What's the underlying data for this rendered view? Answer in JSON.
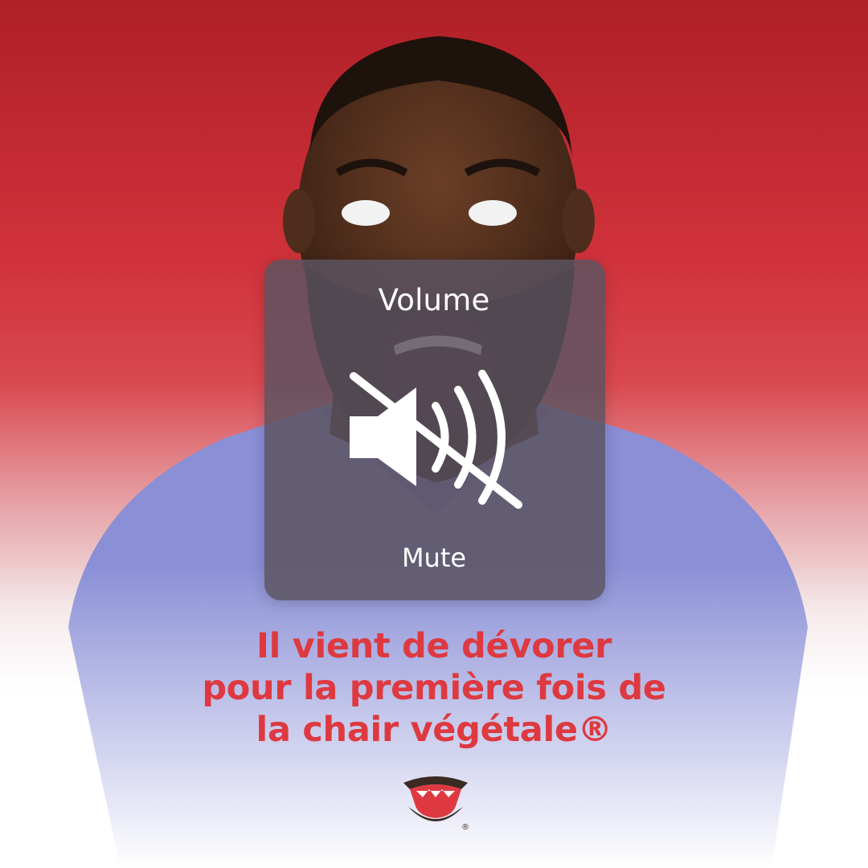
{
  "hud": {
    "title": "Volume",
    "status": "Mute"
  },
  "headline": {
    "lines": [
      "Il vient de dévorer",
      "pour la première fois de",
      "la chair végétale®"
    ]
  },
  "logo": {
    "mark": "®"
  },
  "colors": {
    "background_top": "#b01f28",
    "headline": "#de3940",
    "shirt": "#8a8fd6",
    "skin": "#4a2a1a",
    "hud": "#5c5460"
  },
  "icons": {
    "speaker": "speaker-muted-icon",
    "logo": "open-mouth-logo"
  }
}
